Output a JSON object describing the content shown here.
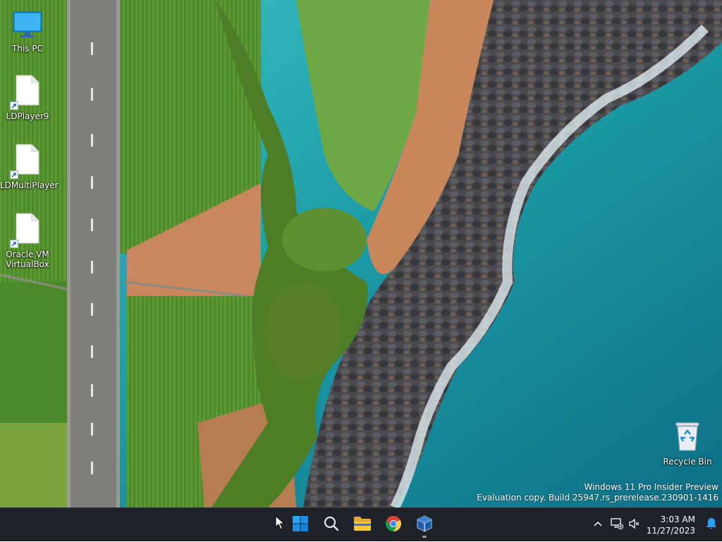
{
  "desktop": {
    "icons": [
      {
        "label": "This PC",
        "icon": "monitor-icon"
      },
      {
        "label": "LDPlayer9",
        "icon": "blank-document-icon"
      },
      {
        "label": "LDMultiPlayer",
        "icon": "blank-document-icon"
      },
      {
        "label": "Oracle VM VirtualBox",
        "icon": "blank-document-icon"
      },
      {
        "label": "Recycle Bin",
        "icon": "recycle-bin-icon"
      }
    ]
  },
  "watermark": {
    "line1": "Windows 11 Pro Insider Preview",
    "line2": "Evaluation copy. Build 25947.rs_prerelease.230901-1416"
  },
  "taskbar": {
    "pinned": [
      {
        "name": "Start",
        "icon": "windows-logo-icon"
      },
      {
        "name": "Search",
        "icon": "search-icon"
      },
      {
        "name": "File Explorer",
        "icon": "folder-icon"
      },
      {
        "name": "Google Chrome",
        "icon": "chrome-icon"
      },
      {
        "name": "Oracle VM VirtualBox",
        "icon": "virtualbox-icon",
        "running": true
      }
    ],
    "tray": {
      "time": "3:03 AM",
      "date": "11/27/2023"
    }
  },
  "colors": {
    "taskbar_bg": "#1f2329",
    "accent_blue": "#0a84e8",
    "sea": "#1c9aa6"
  }
}
